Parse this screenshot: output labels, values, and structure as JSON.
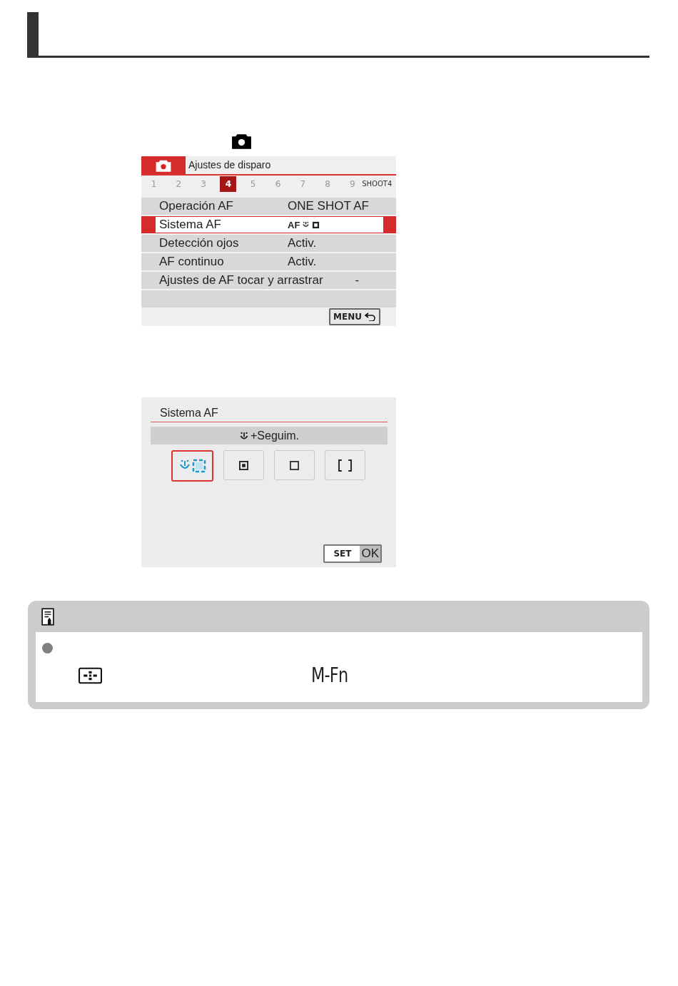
{
  "menu_screen": {
    "tab_title": "Ajustes de disparo",
    "pages": [
      {
        "label": "1",
        "selected": false
      },
      {
        "label": "2",
        "selected": false
      },
      {
        "label": "3",
        "selected": false
      },
      {
        "label": "4",
        "selected": true
      },
      {
        "label": "5",
        "selected": false
      },
      {
        "label": "6",
        "selected": false
      },
      {
        "label": "7",
        "selected": false
      },
      {
        "label": "8",
        "selected": false
      },
      {
        "label": "9",
        "selected": false
      }
    ],
    "page_name": "SHOOT4",
    "items": [
      {
        "label": "Operación AF",
        "value": "ONE SHOT AF",
        "kind": "text",
        "selected": false
      },
      {
        "label": "Sistema AF",
        "value": "AF",
        "kind": "af_method",
        "selected": true
      },
      {
        "label": "Detección ojos",
        "value": "Activ.",
        "kind": "text",
        "selected": false
      },
      {
        "label": "AF continuo",
        "value": "Activ.",
        "kind": "text",
        "selected": false
      },
      {
        "label": "Ajustes de AF tocar y arrastrar",
        "value": "-",
        "kind": "dash",
        "selected": false
      }
    ],
    "menu_key": "MENU"
  },
  "af_screen": {
    "title": "Sistema AF",
    "current": "+Seguim.",
    "options": [
      {
        "kind": "face_tracking",
        "selected": true
      },
      {
        "kind": "spot",
        "selected": false
      },
      {
        "kind": "single",
        "selected": false
      },
      {
        "kind": "zone",
        "selected": false
      }
    ],
    "set_key": "SET",
    "ok_label": "OK"
  },
  "note": {
    "key_label": "M-Fn"
  }
}
